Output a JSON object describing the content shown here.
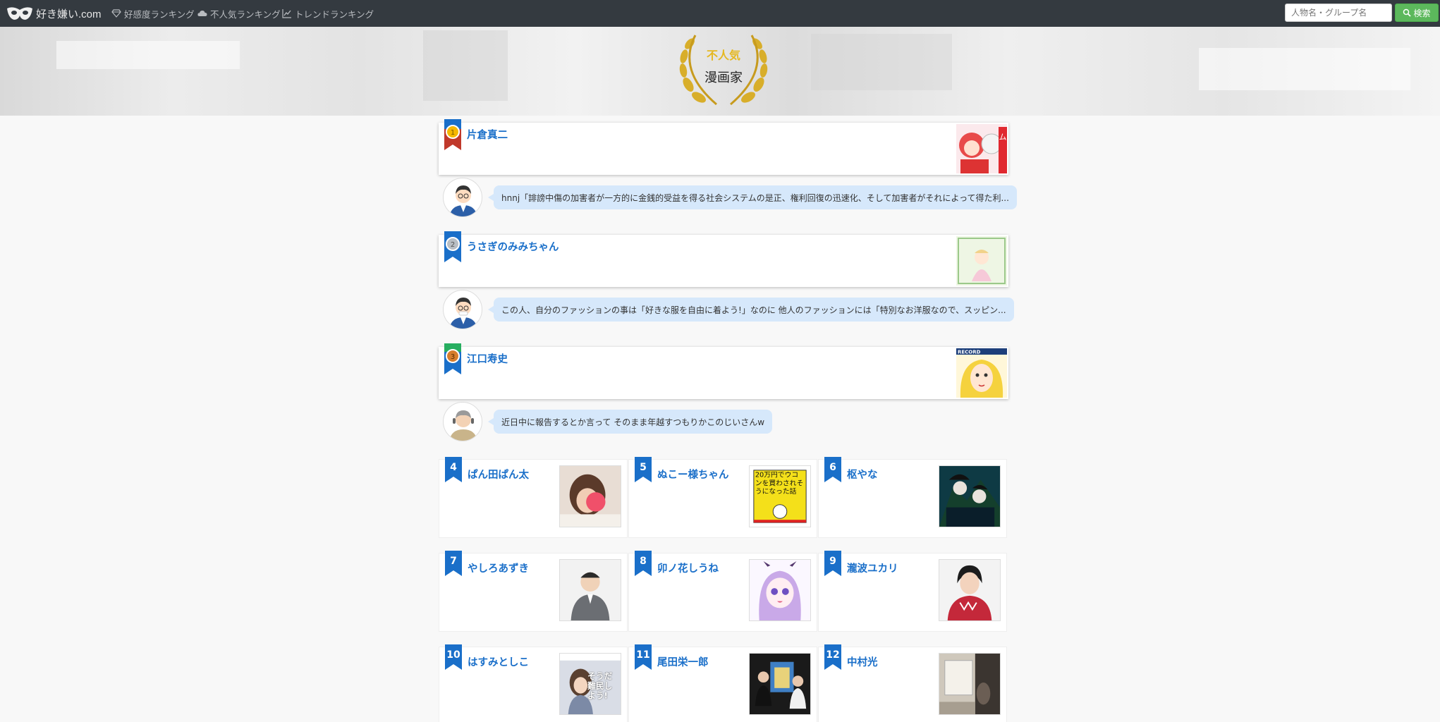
{
  "nav": {
    "brand": "好き嫌い.com",
    "links": [
      "好感度ランキング",
      "不人気ランキング",
      "トレンドランキング"
    ],
    "search_placeholder": "人物名・グループ名",
    "search_button": "検索"
  },
  "hero": {
    "subtitle": "不人気",
    "title": "漫画家"
  },
  "top": [
    {
      "rank": 1,
      "name": "片倉真二",
      "comment": "hnnj「誹謗中傷の加害者が一方的に金銭的受益を得る社会システムの是正、権利回復の迅速化、そして加害者がそれによって得た利..."
    },
    {
      "rank": 2,
      "name": "うさぎのみみちゃん",
      "comment": "この人、自分のファッションの事は「好きな服を自由に着よう!」なのに 他人のファッションには「特別なお洋服なので、スッピン..."
    },
    {
      "rank": 3,
      "name": "江口寿史",
      "comment": "近日中に報告するとか言って そのまま年越すつもりかこのじいさんw",
      "thumb_text": "RECORD"
    }
  ],
  "grid": [
    {
      "rank": "4",
      "name": "ぱん田ぱん太"
    },
    {
      "rank": "5",
      "name": "ぬこー様ちゃん",
      "thumb_text": "20万円でウコンを買わされそうになった話"
    },
    {
      "rank": "6",
      "name": "枢やな"
    },
    {
      "rank": "7",
      "name": "やしろあずき"
    },
    {
      "rank": "8",
      "name": "卯ノ花しうね"
    },
    {
      "rank": "9",
      "name": "瀧波ユカリ"
    },
    {
      "rank": "10",
      "name": "はすみとしこ",
      "thumb_text": "そうだ難民しよう!"
    },
    {
      "rank": "11",
      "name": "尾田栄一郎"
    },
    {
      "rank": "12",
      "name": "中村光"
    }
  ]
}
